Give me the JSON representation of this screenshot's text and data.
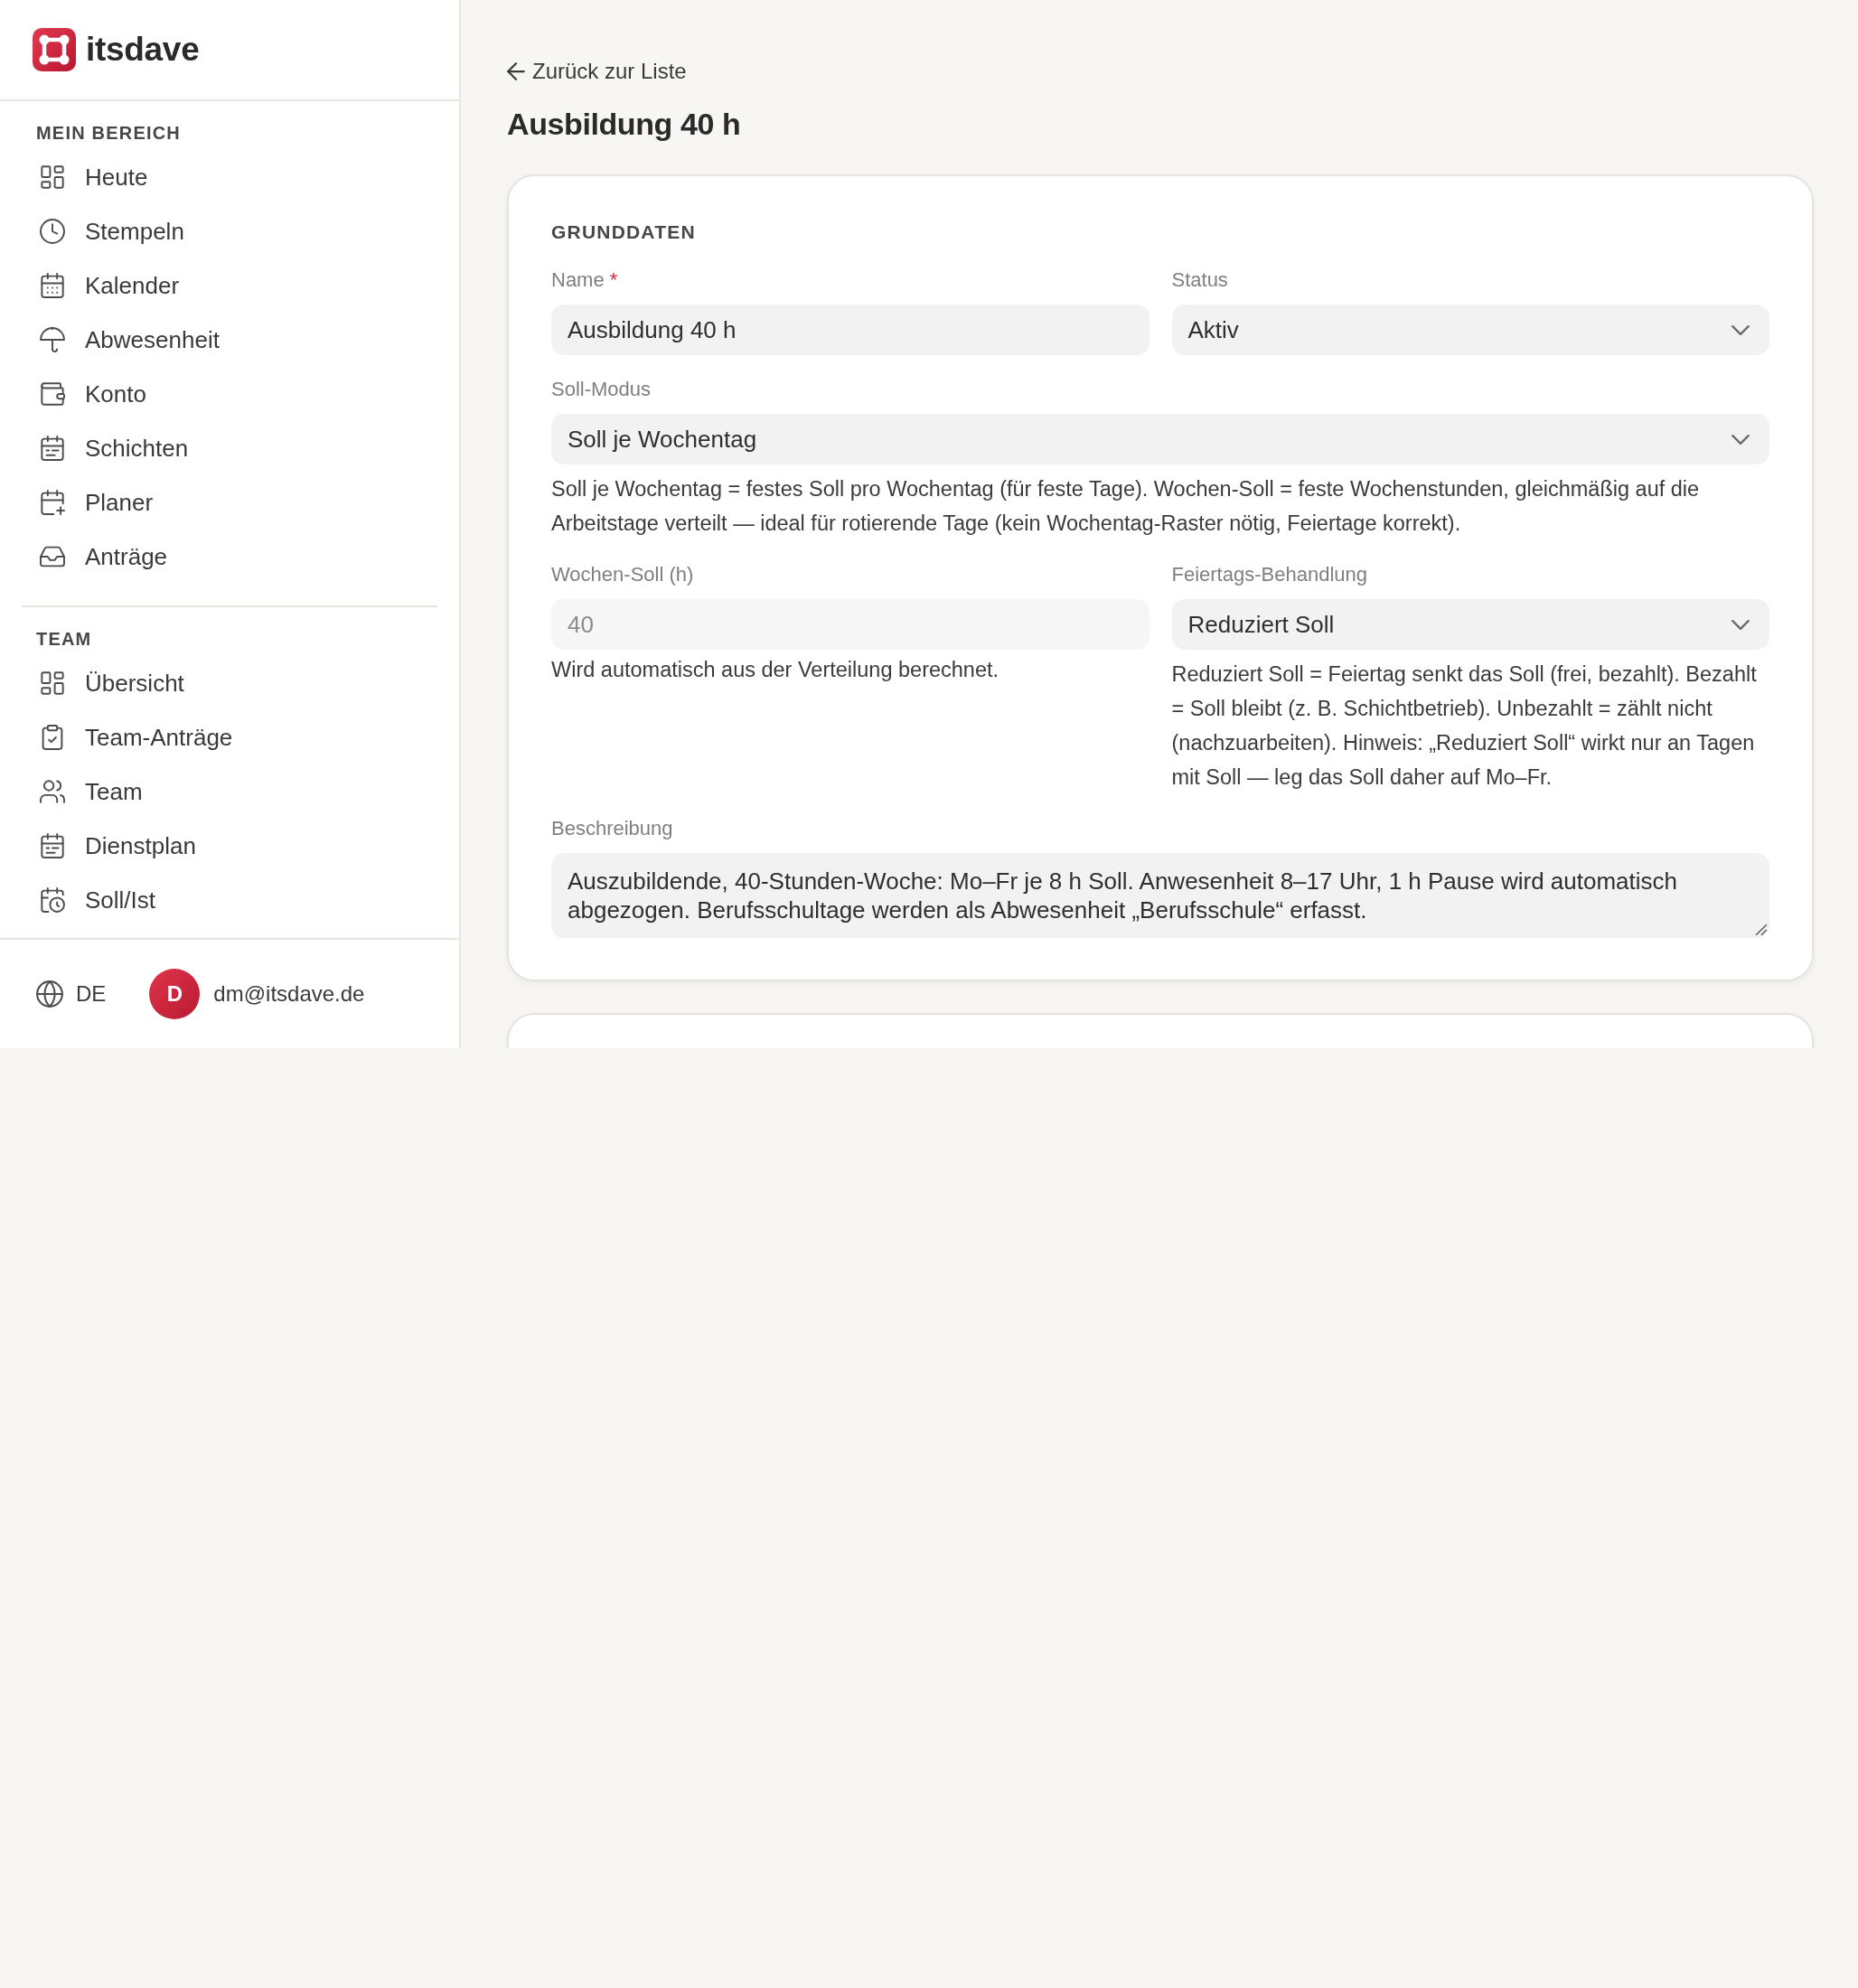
{
  "sidebar": {
    "brand": "itsdave",
    "sections": [
      {
        "heading": "MEIN BEREICH",
        "items": [
          {
            "label": "Heute",
            "selected": false
          },
          {
            "label": "Stempeln",
            "selected": false
          },
          {
            "label": "Kalender",
            "selected": false
          },
          {
            "label": "Abwesenheit",
            "selected": false
          },
          {
            "label": "Konto",
            "selected": false
          },
          {
            "label": "Schichten",
            "selected": false
          },
          {
            "label": "Planer",
            "selected": false
          },
          {
            "label": "Anträge",
            "selected": false
          }
        ]
      },
      {
        "heading": "TEAM",
        "items": [
          {
            "label": "Übersicht",
            "selected": false
          },
          {
            "label": "Team-Anträge",
            "selected": false
          },
          {
            "label": "Team",
            "selected": false
          },
          {
            "label": "Dienstplan",
            "selected": false
          },
          {
            "label": "Soll/Ist",
            "selected": false
          }
        ]
      }
    ],
    "footer": {
      "language": "DE",
      "avatar_initial": "D",
      "email": "dm@itsdave.de"
    }
  },
  "page": {
    "back_link": "Zurück zur Liste",
    "title": "Ausbildung 40 h"
  },
  "form": {
    "section_title": "GRUNDDATEN",
    "rows": [
      [
        {
          "kind": "text",
          "label": "Name",
          "required_mark": "*",
          "value": "Ausbildung 40 h",
          "disabled": false
        },
        {
          "kind": "select",
          "label": "Status",
          "value": "Aktiv",
          "disabled": false
        }
      ],
      [
        {
          "kind": "select",
          "label": "Soll-Modus",
          "value": "Soll je Wochentag",
          "disabled": false,
          "help": "Soll je Wochentag = festes Soll pro Wochentag (für feste Tage). Wochen-Soll = feste Wochenstunden, gleichmäßig auf die Arbeitstage verteilt — ideal für rotierende Tage (kein Wochentag-Raster nötig, Feiertage korrekt)."
        }
      ],
      [
        {
          "kind": "text",
          "label": "Wochen-Soll (h)",
          "value": "40",
          "disabled": true,
          "help": "Wird automatisch aus der Verteilung berechnet."
        },
        {
          "kind": "select",
          "label": "Feiertags-Behandlung",
          "value": "Reduziert Soll",
          "disabled": false,
          "help": "Reduziert Soll = Feiertag senkt das Soll (frei, bezahlt). Bezahlt = Soll bleibt (z. B. Schichtbetrieb). Unbezahlt = zählt nicht (nachzuarbeiten). Hinweis: „Reduziert Soll“ wirkt nur an Tagen mit Soll — leg das Soll daher auf Mo–Fr."
        }
      ],
      [
        {
          "kind": "textarea",
          "label": "Beschreibung",
          "value": "Auszubildende, 40-Stunden-Woche: Mo–Fr je 8 h Soll. Anwesenheit 8–17 Uhr, 1 h Pause wird automatisch abgezogen. Berufsschultage werden als Abwesenheit „Berufsschule“ erfasst.",
          "disabled": false
        }
      ]
    ]
  }
}
